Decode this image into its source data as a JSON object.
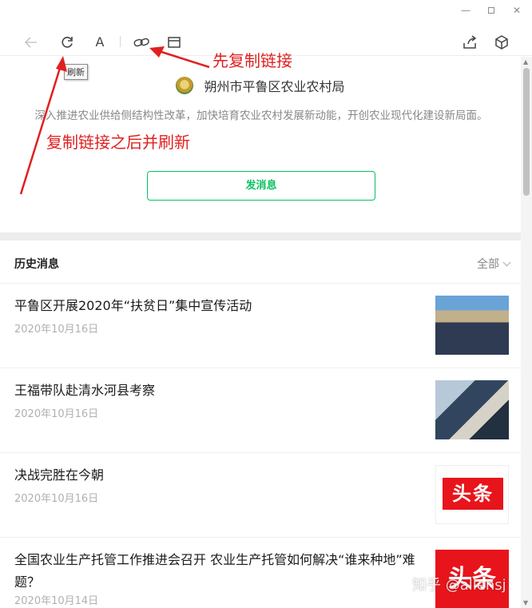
{
  "window": {
    "minimize_icon": "minimize-icon",
    "maximize_icon": "maximize-icon",
    "close_icon": "close-icon"
  },
  "toolbar": {
    "font_label": "A",
    "tooltip": "刷新",
    "icons": [
      "back-arrow-icon",
      "refresh-icon",
      "font-size-icon",
      "copy-link-icon",
      "open-window-icon",
      "share-icon",
      "cube-icon"
    ]
  },
  "annotations": {
    "first": "先复制链接",
    "second": "复制链接之后并刷新",
    "color": "#e02020"
  },
  "account": {
    "name": "朔州市平鲁区农业农村局",
    "description": "深入推进农业供给侧结构性改革，加快培育农业农村发展新动能，开创农业现代化建设新局面。",
    "send_button": "发消息",
    "accent_color": "#07c160"
  },
  "history": {
    "title": "历史消息",
    "filter": "全部",
    "articles": [
      {
        "title": "平鲁区开展2020年“扶贫日”集中宣传活动",
        "date": "2020年10月16日"
      },
      {
        "title": "王福带队赴清水河县考察",
        "date": "2020年10月16日"
      },
      {
        "title": "决战完胜在今朝",
        "date": "2020年10月16日",
        "thumb_text": "头条"
      },
      {
        "title": "全国农业生产托管工作推进会召开 农业生产托管如何解决“谁来种地”难题？",
        "date": "2020年10月14日",
        "thumb_text": "头条"
      }
    ]
  },
  "watermark": "知乎 @allensj"
}
